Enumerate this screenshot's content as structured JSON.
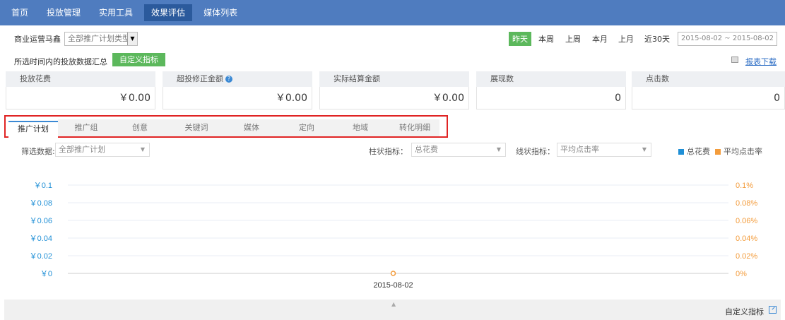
{
  "nav": {
    "items": [
      "首页",
      "投放管理",
      "实用工具",
      "效果评估",
      "媒体列表"
    ],
    "active_index": 3
  },
  "toolbar": {
    "business_name": "商业运营马鑫",
    "plan_type_select": "全部推广计划类型",
    "periods": [
      "昨天",
      "本周",
      "上周",
      "本月",
      "上月",
      "近30天"
    ],
    "active_period": "昨天",
    "date_range": "2015-08-02 ~ 2015-08-02"
  },
  "summary": {
    "text": "所选时间内的投放数据汇总",
    "custom_metrics_button": "自定义指标",
    "download_link": "报表下载"
  },
  "metrics": [
    {
      "label": "投放花费",
      "value": "￥0.00"
    },
    {
      "label": "超投修正金额",
      "value": "￥0.00",
      "help_icon": "question-circle-icon"
    },
    {
      "label": "实际结算金额",
      "value": "￥0.00"
    },
    {
      "label": "展现数",
      "value": "0"
    },
    {
      "label": "点击数",
      "value": "0"
    }
  ],
  "tabs": [
    "推广计划",
    "推广组",
    "创意",
    "关键词",
    "媒体",
    "定向",
    "地域",
    "转化明细"
  ],
  "active_tab": "推广计划",
  "filters": {
    "data_label": "筛选数据:",
    "data_value": "全部推广计划",
    "bar_label": "柱状指标：",
    "bar_value": "总花费",
    "line_label": "线状指标：",
    "line_value": "平均点击率"
  },
  "colors": {
    "bar_series": "#1f8fd6",
    "line_series": "#f39c3c",
    "nav_bg": "#4f7cbf",
    "highlight_border": "#e02424",
    "green": "#5cb85c"
  },
  "chart_data": {
    "type": "bar",
    "categories": [
      "2015-08-02"
    ],
    "series": [
      {
        "name": "总花费",
        "axis": "left",
        "values": [
          0
        ]
      },
      {
        "name": "平均点击率",
        "axis": "right",
        "values": [
          0
        ]
      }
    ],
    "left_ticks": [
      "￥0",
      "￥0.02",
      "￥0.04",
      "￥0.06",
      "￥0.08",
      "￥0.1"
    ],
    "right_ticks": [
      "0%",
      "0.02%",
      "0.04%",
      "0.06%",
      "0.08%",
      "0.1%"
    ],
    "ylim": [
      0,
      0.1
    ],
    "grid": true,
    "legend_position": "top-right"
  },
  "footer": {
    "custom_metrics_link": "自定义指标"
  }
}
